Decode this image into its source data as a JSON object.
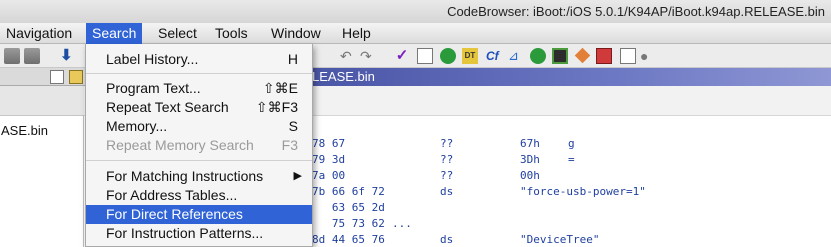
{
  "window": {
    "title": "CodeBrowser: iBoot:/iOS 5.0.1/K94AP/iBoot.k94ap.RELEASE.bin"
  },
  "menubar": {
    "items": [
      "Navigation",
      "Search",
      "Select",
      "Tools",
      "Window",
      "Help"
    ],
    "active": "Search"
  },
  "tab": {
    "title": "LEASE.bin"
  },
  "left_panel": {
    "item": "ASE.bin"
  },
  "search_menu": {
    "items": [
      {
        "label": "Label History...",
        "shortcut": "H",
        "enabled": true
      },
      {
        "label": "Program Text...",
        "shortcut": "⇧⌘E",
        "enabled": true
      },
      {
        "label": "Repeat Text Search",
        "shortcut": "⇧⌘F3",
        "enabled": true
      },
      {
        "label": "Memory...",
        "shortcut": "S",
        "enabled": true
      },
      {
        "label": "Repeat Memory Search",
        "shortcut": "F3",
        "enabled": false
      },
      {
        "label": "For Matching Instructions",
        "submenu": "▶",
        "enabled": true
      },
      {
        "label": "For Address Tables...",
        "enabled": true
      },
      {
        "label": "For Direct References",
        "enabled": true,
        "highlighted": true
      },
      {
        "label": "For Instruction Patterns...",
        "enabled": true
      }
    ]
  },
  "listing": {
    "rows": [
      {
        "bytes": "78 67",
        "mnemonic": "??",
        "operand": "67h",
        "operand2": "g"
      },
      {
        "bytes": "79 3d",
        "mnemonic": "??",
        "operand": "3Dh",
        "operand2": "="
      },
      {
        "bytes": "7a 00",
        "mnemonic": "??",
        "operand": "00h",
        "operand2": ""
      },
      {
        "bytes": "7b 66 6f 72",
        "mnemonic": "ds",
        "operand": "\"force-usb-power=1\"",
        "operand2": ""
      },
      {
        "bytes": "   63 65 2d",
        "mnemonic": "",
        "operand": "",
        "operand2": ""
      },
      {
        "bytes": "   75 73 62",
        "mnemonic": "",
        "operand": "",
        "operand2": "",
        "ellipsis": "..."
      },
      {
        "bytes": "8d 44 65 76",
        "mnemonic": "ds",
        "operand": "\"DeviceTree\"",
        "operand2": ""
      }
    ]
  },
  "colors": {
    "menu_highlight": "#2f63d6",
    "tab_active": "#4a56a6",
    "listing_text": "#1f3f9f"
  }
}
